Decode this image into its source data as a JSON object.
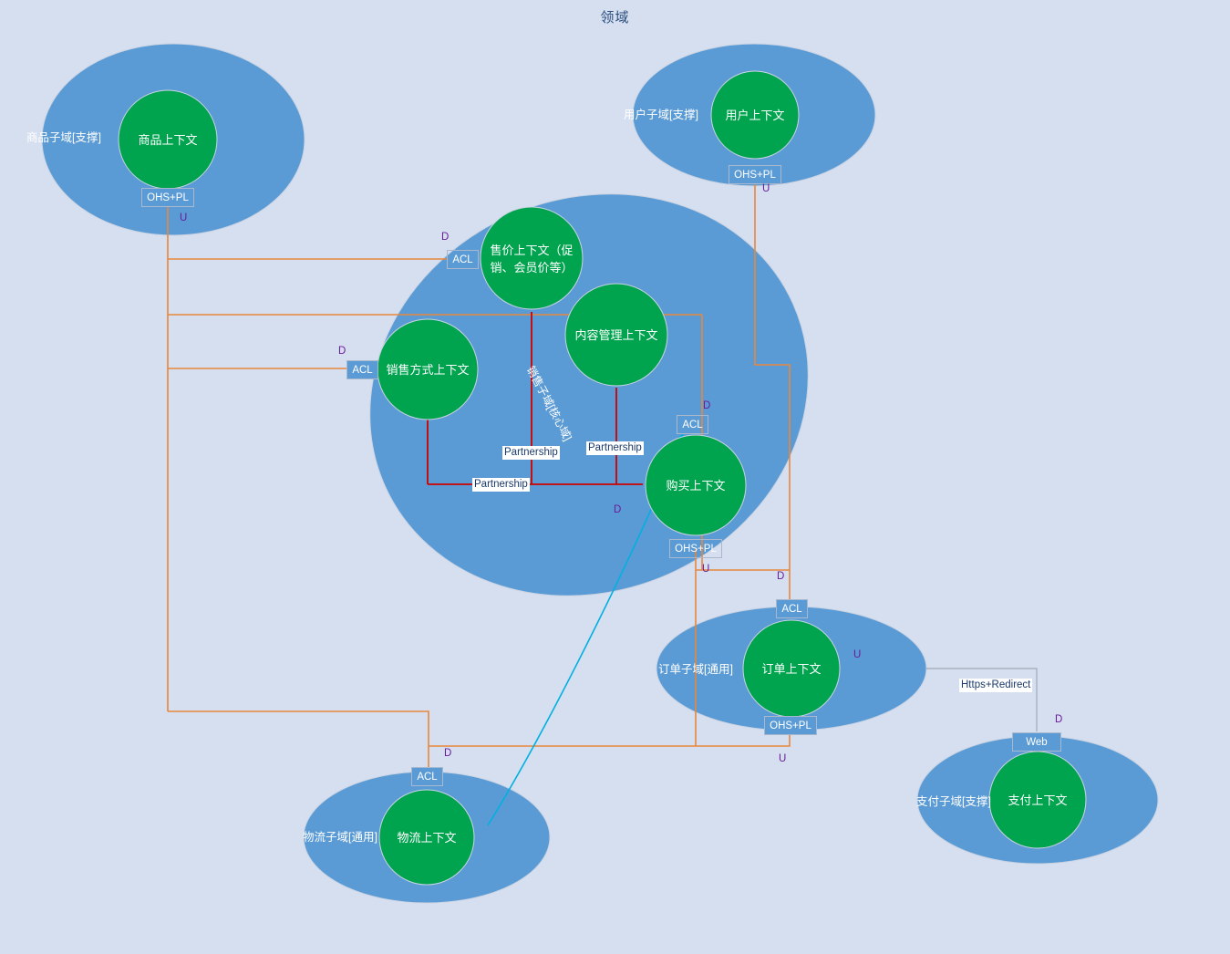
{
  "title": "领域",
  "colors": {
    "background": "#d5dff0",
    "subdomain_fill": "#5b9bd5",
    "context_fill": "#00a44f",
    "orange_edge": "#e8873c",
    "red_edge": "#cc0000",
    "cyan_edge": "#00b0e0",
    "gray_edge": "#a0a8b4",
    "badge_fill": "#5b9bd5",
    "tag_text": "#6a1b9a",
    "title_text": "#2a4e7e"
  },
  "subdomains": [
    {
      "id": "product",
      "label": "商品子域[支撑]",
      "context": "商品上下文"
    },
    {
      "id": "user",
      "label": "用户子域[支撑]",
      "context": "用户上下文"
    },
    {
      "id": "sales",
      "label": "销售子域[核心域]",
      "context": ""
    },
    {
      "id": "order",
      "label": "订单子域[通用]",
      "context": "订单上下文"
    },
    {
      "id": "logistics",
      "label": "物流子域[通用]",
      "context": "物流上下文"
    },
    {
      "id": "payment",
      "label": "支付子域[支撑]",
      "context": "支付上下文"
    }
  ],
  "contexts": [
    {
      "id": "product",
      "label": "商品上下文"
    },
    {
      "id": "user",
      "label": "用户上下文"
    },
    {
      "id": "price",
      "label": "售价上下文（促销、会员价等）"
    },
    {
      "id": "content",
      "label": "内容管理上下文"
    },
    {
      "id": "saleway",
      "label": "销售方式上下文"
    },
    {
      "id": "purchase",
      "label": "购买上下文"
    },
    {
      "id": "order",
      "label": "订单上下文"
    },
    {
      "id": "logistics",
      "label": "物流上下文"
    },
    {
      "id": "payment",
      "label": "支付上下文"
    }
  ],
  "badges": [
    {
      "id": "product-ohspl",
      "text": "OHS+PL"
    },
    {
      "id": "user-ohspl",
      "text": "OHS+PL"
    },
    {
      "id": "price-acl",
      "text": "ACL"
    },
    {
      "id": "saleway-acl",
      "text": "ACL"
    },
    {
      "id": "purchase-acl",
      "text": "ACL"
    },
    {
      "id": "purchase-ohspl",
      "text": "OHS+PL"
    },
    {
      "id": "order-acl",
      "text": "ACL"
    },
    {
      "id": "order-ohspl",
      "text": "OHS+PL"
    },
    {
      "id": "logistics-acl",
      "text": "ACL"
    },
    {
      "id": "payment-web",
      "text": "Web"
    }
  ],
  "edge_labels": [
    {
      "id": "partnership-1",
      "text": "Partnership"
    },
    {
      "id": "partnership-2",
      "text": "Partnership"
    },
    {
      "id": "partnership-3",
      "text": "Partnership"
    },
    {
      "id": "https-redirect",
      "text": "Https+Redirect"
    }
  ],
  "relation_tags": [
    {
      "id": "tag-product-u",
      "text": "U"
    },
    {
      "id": "tag-user-u",
      "text": "U"
    },
    {
      "id": "tag-price-d",
      "text": "D"
    },
    {
      "id": "tag-saleway-d",
      "text": "D"
    },
    {
      "id": "tag-purchase-d",
      "text": "D"
    },
    {
      "id": "tag-purchase-d2",
      "text": "D"
    },
    {
      "id": "tag-purchase-u",
      "text": "U"
    },
    {
      "id": "tag-order-d",
      "text": "D"
    },
    {
      "id": "tag-order-u",
      "text": "U"
    },
    {
      "id": "tag-order-u2",
      "text": "U"
    },
    {
      "id": "tag-logistics-d",
      "text": "D"
    },
    {
      "id": "tag-payment-d",
      "text": "D"
    }
  ]
}
